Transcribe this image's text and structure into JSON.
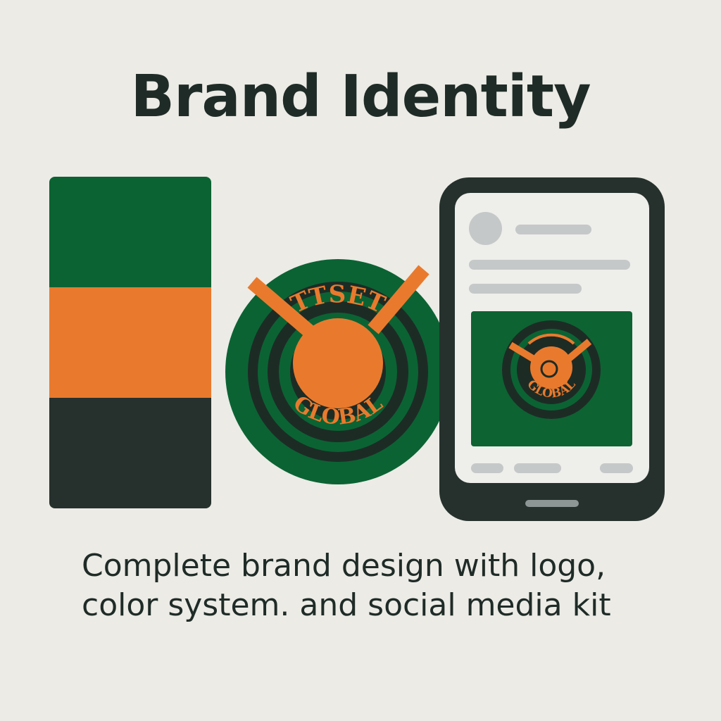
{
  "title": "Brand Identity",
  "caption": {
    "line1": "Complete brand design with logo,",
    "line2": "color system. and social media kit"
  },
  "palette": {
    "colors": [
      "#0b6333",
      "#e97a2d",
      "#26312d"
    ]
  },
  "logo": {
    "top_text": "TTSET",
    "bottom_text": "GLOBAL",
    "colors": {
      "green": "#0b6333",
      "orange": "#e97a2d",
      "dark": "#1d2b25"
    }
  },
  "phone_mockup": {
    "post_logo_text": "GLOBAL",
    "frame_color": "#26312d",
    "placeholder_color": "#c5c8c8"
  }
}
